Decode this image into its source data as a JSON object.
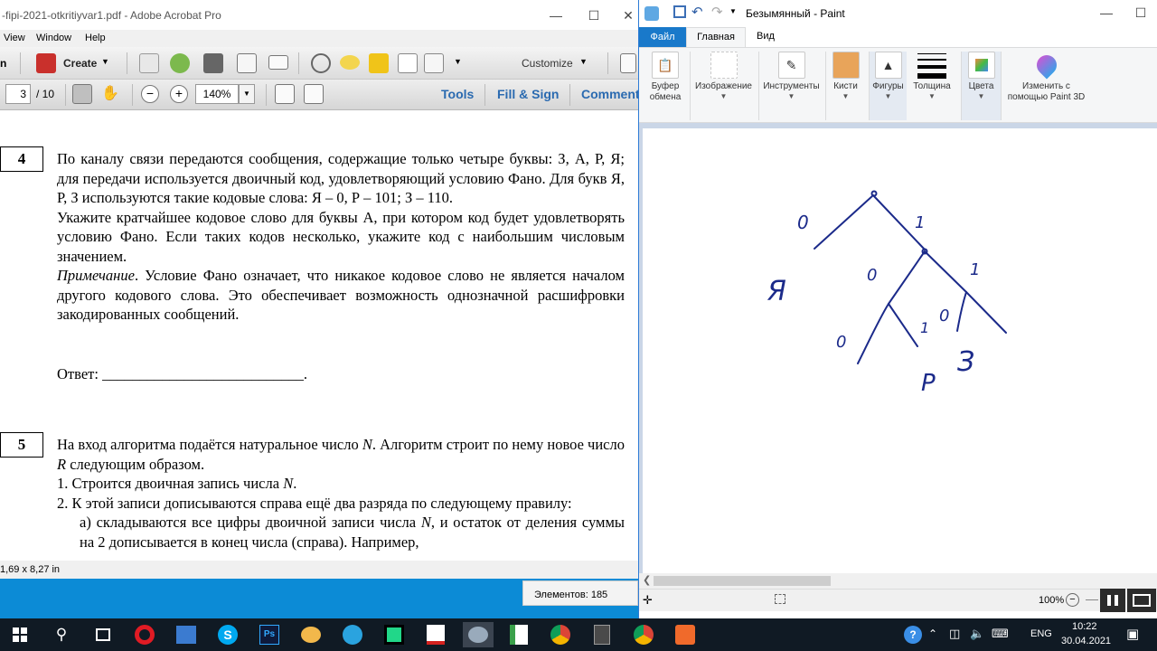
{
  "acrobat": {
    "title": "-fipi-2021-otkritiyvar1.pdf - Adobe Acrobat Pro",
    "menu": [
      "View",
      "Window",
      "Help"
    ],
    "menu_open_fragment": "n",
    "create_label": "Create",
    "customize_label": "Customize",
    "page_current": "3",
    "page_total": "/ 10",
    "zoom": "140%",
    "tools_label": "Tools",
    "fill_sign_label": "Fill & Sign",
    "comment_label": "Comment",
    "page_size": "1,69 x 8,27 in"
  },
  "document": {
    "task4_num": "4",
    "task4_p1": "По каналу связи передаются сообщения, содержащие только четыре буквы: З, А, Р, Я; для передачи используется двоичный код, удовлетворяющий условию Фано. Для букв Я, Р, З используются такие кодовые слова: Я – 0, Р – 101; З – 110.",
    "task4_p2": "Укажите кратчайшее кодовое слово для буквы А, при котором код будет удовлетворять условию Фано. Если таких кодов несколько, укажите код с наибольшим числовым значением.",
    "task4_note_em": "Примечание",
    "task4_note": ". Условие Фано означает, что никакое кодовое слово не является началом другого кодового слова. Это обеспечивает возможность однозначной расшифровки закодированных сообщений.",
    "answer_label": "Ответ: ",
    "answer_line": "___________________________.",
    "task5_num": "5",
    "task5_p1_a": "На вход алгоритма подаётся натуральное число ",
    "task5_N": "N",
    "task5_p1_b": ". Алгоритм строит по нему новое число ",
    "task5_R": "R",
    "task5_p1_c": " следующим образом.",
    "task5_l1_a": "1. Строится двоичная запись числа ",
    "task5_l1_N": "N",
    "task5_l1_b": ".",
    "task5_l2": "2. К этой записи дописываются справа ещё два разряда по следующему правилу:",
    "task5_la_a": "а) складываются все цифры двоичной записи числа ",
    "task5_la_N": "N",
    "task5_la_b": ", и остаток от деления суммы на 2 дописывается в конец числа (справа). Например,"
  },
  "paint": {
    "title": "Безымянный - Paint",
    "tab_file": "Файл",
    "tab_home": "Главная",
    "tab_view": "Вид",
    "groups": {
      "clipboard": "Буфер обмена",
      "image": "Изображение",
      "tools": "Инструменты",
      "brushes": "Кисти",
      "shapes": "Фигуры",
      "thickness": "Толщина",
      "colors": "Цвета",
      "paint3d": "Изменить с помощью Paint 3D"
    },
    "zoom": "100%",
    "elements_count": "Элементов: 185",
    "drawing_labels": {
      "zero_left": "0",
      "one_top": "1",
      "ya": "Я",
      "zero_mid": "0",
      "one_right": "1",
      "zero_low": "0",
      "one_low": "1",
      "zero_inner": "0",
      "ze": "З",
      "er": "Р"
    }
  },
  "taskbar": {
    "lang": "ENG",
    "time": "10:22",
    "date": "30.04.2021"
  },
  "colors": {
    "accent": "#1979ca",
    "ink": "#1b2a8a",
    "taskbar": "#101a24",
    "desktop": "#0c8bd6"
  }
}
